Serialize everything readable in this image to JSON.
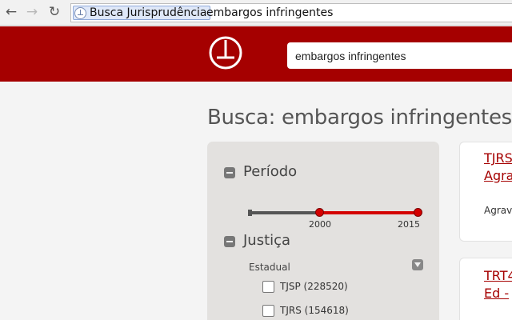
{
  "browser": {
    "tab_chip_label": "Busca Jurisprudência",
    "address_text": "embargos infringentes",
    "back_icon": "back-arrow-icon",
    "forward_icon": "forward-arrow-icon",
    "reload_icon": "reload-icon"
  },
  "header": {
    "search_value": "embargos infringentes",
    "brand_color": "#a50000"
  },
  "page": {
    "title": "Busca: embargos infringentes"
  },
  "filters": {
    "periodo": {
      "title": "Período",
      "tick_labels": [
        "2000",
        "2015"
      ]
    },
    "justica": {
      "title": "Justiça",
      "sublabel": "Estadual",
      "options": [
        {
          "label": "TJSP (228520)",
          "checked": false
        },
        {
          "label": "TJRS (154618)",
          "checked": false
        }
      ]
    }
  },
  "results": [
    {
      "title_lines": [
        "TJRS",
        "Agra"
      ],
      "snippet": "Agrav"
    },
    {
      "title_lines": [
        "TRT4",
        "Ed -"
      ]
    }
  ]
}
